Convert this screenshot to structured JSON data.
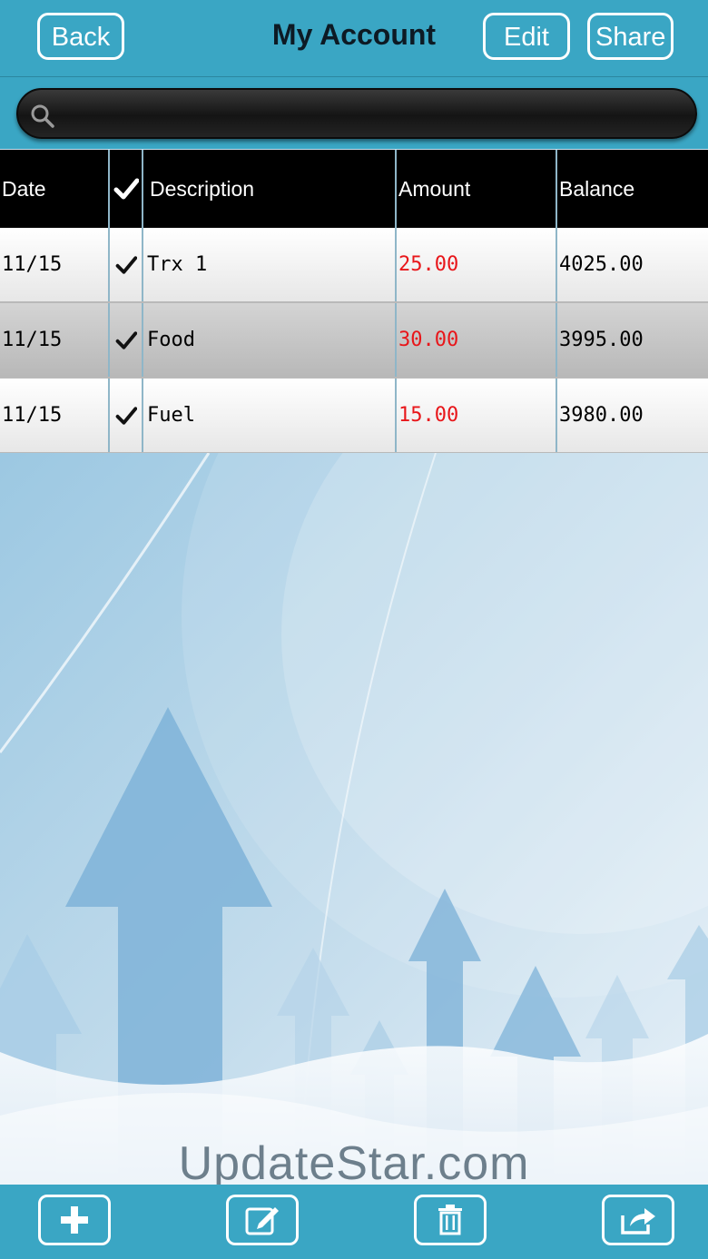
{
  "header": {
    "title": "My Account",
    "back_label": "Back",
    "edit_label": "Edit",
    "share_label": "Share"
  },
  "search": {
    "placeholder": "",
    "value": ""
  },
  "table": {
    "columns": {
      "date": "Date",
      "check": "",
      "description": "Description",
      "amount": "Amount",
      "balance": "Balance"
    },
    "rows": [
      {
        "date": "11/15",
        "description": "Trx 1",
        "amount": "25.00",
        "balance": "4025.00"
      },
      {
        "date": "11/15",
        "description": "Food",
        "amount": "30.00",
        "balance": "3995.00"
      },
      {
        "date": "11/15",
        "description": "Fuel",
        "amount": "15.00",
        "balance": "3980.00"
      }
    ]
  },
  "watermark": "UpdateStar.com",
  "toolbar": {
    "icons": [
      "plus-icon",
      "edit-note-icon",
      "trash-icon",
      "share-icon"
    ]
  },
  "colors": {
    "accent": "#3aa6c4",
    "amount": "#e8161a",
    "header_row": "#000000"
  }
}
